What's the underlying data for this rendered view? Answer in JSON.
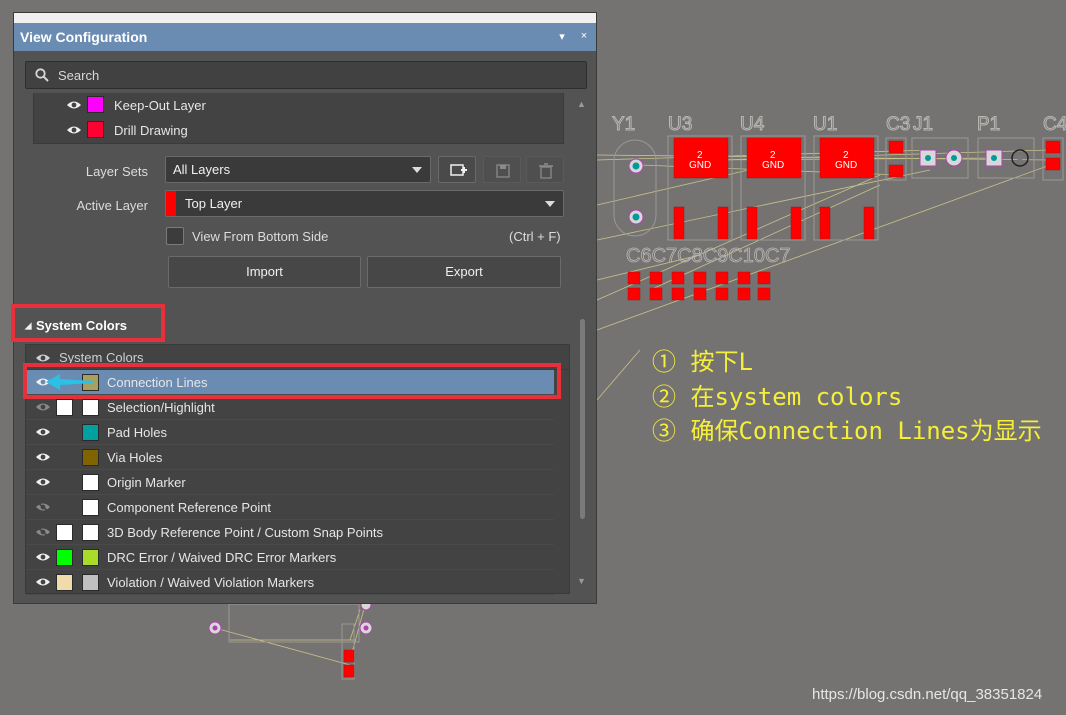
{
  "panel": {
    "title": "View Configuration",
    "pin_glyph": "▾",
    "close_glyph": "×"
  },
  "search": {
    "placeholder": "Search"
  },
  "layers": [
    {
      "name": "Keep-Out Layer",
      "color": "#ff00ff",
      "visible": true
    },
    {
      "name": "Drill Drawing",
      "color": "#ff0033",
      "visible": true
    }
  ],
  "form": {
    "layer_sets_label": "Layer Sets",
    "layer_sets_value": "All Layers",
    "active_layer_label": "Active Layer",
    "active_layer_value": "Top Layer",
    "active_layer_color": "#ff0000",
    "view_bottom_label": "View From Bottom Side",
    "view_bottom_shortcut": "(Ctrl + F)",
    "import_label": "Import",
    "export_label": "Export"
  },
  "system_colors": {
    "section_title": "System Colors",
    "list_header": "System Colors",
    "items": [
      {
        "name": "Connection Lines",
        "color": "#a8a060",
        "visible": true,
        "selected": true
      },
      {
        "name": "Selection/Highlight",
        "color": "#ffffff",
        "color2": "#ffffff",
        "visible": true,
        "dim": true
      },
      {
        "name": "Pad Holes",
        "color": "#00a0a0",
        "visible": true
      },
      {
        "name": "Via Holes",
        "color": "#806400",
        "visible": true
      },
      {
        "name": "Origin Marker",
        "color": "#ffffff",
        "visible": true
      },
      {
        "name": "Component Reference Point",
        "color": "#ffffff",
        "visible": false
      },
      {
        "name": "3D Body Reference Point / Custom Snap Points",
        "color": "#ffffff",
        "color2": "#ffffff",
        "visible": false
      },
      {
        "name": "DRC Error / Waived DRC Error Markers",
        "color": "#a8dc28",
        "color2": "#00ff00",
        "visible": true
      },
      {
        "name": "Violation / Waived Violation Markers",
        "color": "#c0c0c0",
        "color2": "#f0dcaa",
        "visible": true
      }
    ]
  },
  "annotations": [
    "① 按下L",
    "② 在system colors",
    "③ 确保Connection Lines为显示"
  ],
  "pcb": {
    "designators": [
      "Y1",
      "U3",
      "U4",
      "U1",
      "C3",
      "J1",
      "P1",
      "C4"
    ],
    "pad_labels": [
      "2",
      "GND"
    ],
    "silk_text": "C6C7C8C9C10C7"
  },
  "watermark": "https://blog.csdn.net/qq_38351824"
}
